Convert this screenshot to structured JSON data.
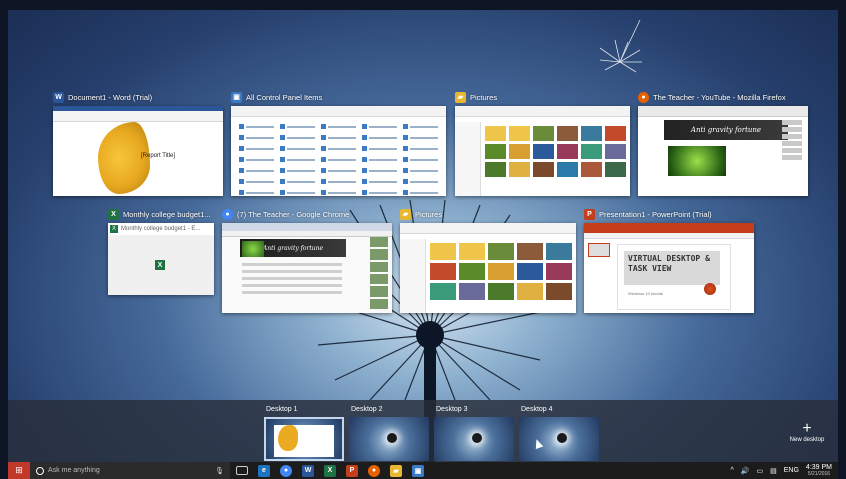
{
  "windows": [
    {
      "title": "Document1 - Word (Trial)",
      "icon": "word-icon",
      "color": "#2b579a",
      "glyph": "W",
      "report_title": "[Report Title]"
    },
    {
      "title": "All Control Panel Items",
      "icon": "control-panel-icon",
      "color": "#3b7bc6",
      "glyph": "▣"
    },
    {
      "title": "Pictures",
      "icon": "folder-icon",
      "color": "#e8b730",
      "glyph": "▰"
    },
    {
      "title": "The Teacher - YouTube - Mozilla Firefox",
      "icon": "firefox-icon",
      "color": "#e66000",
      "glyph": "●",
      "banner": "Anti gravity fortune"
    },
    {
      "title": "Monthly college budget1...",
      "icon": "excel-icon",
      "color": "#1f7244",
      "glyph": "X",
      "inner_title": "Monthly college budget1 - E..."
    },
    {
      "title": "(7) The Teacher - Google Chrome",
      "icon": "chrome-icon",
      "color": "#4285f4",
      "glyph": "●",
      "banner": "Anti gravity fortune"
    },
    {
      "title": "Pictures",
      "icon": "folder-icon",
      "color": "#e8b730",
      "glyph": "▰"
    },
    {
      "title": "Presentation1 - PowerPoint (Trial)",
      "icon": "powerpoint-icon",
      "color": "#c43e1c",
      "glyph": "P",
      "slide_heading": "VIRTUAL DESKTOP & TASK VIEW",
      "slide_sub": "Windows 10 tutorial"
    }
  ],
  "desktops": [
    {
      "label": "Desktop 1"
    },
    {
      "label": "Desktop 2"
    },
    {
      "label": "Desktop 3"
    },
    {
      "label": "Desktop 4"
    }
  ],
  "new_desktop": {
    "label": "New desktop",
    "icon": "plus-icon"
  },
  "taskbar": {
    "search_placeholder": "Ask me anything",
    "lang": "ENG",
    "time": "4:39 PM",
    "date": "5/21/2016",
    "icons": [
      "task-view-icon",
      "edge-icon",
      "chrome-icon",
      "word-icon",
      "excel-icon",
      "powerpoint-icon",
      "firefox-icon",
      "file-explorer-icon",
      "store-icon"
    ]
  }
}
